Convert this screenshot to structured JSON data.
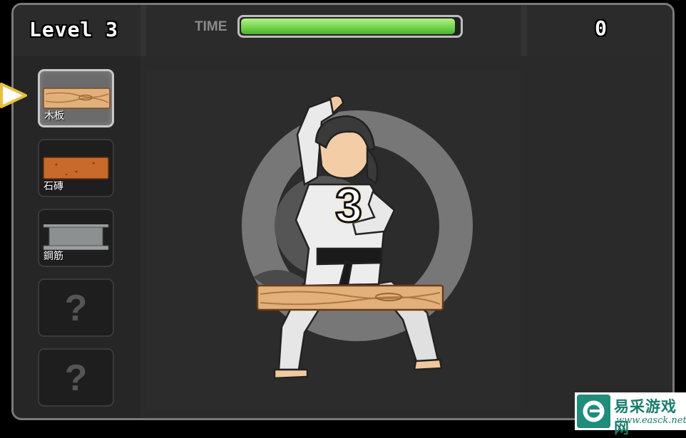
{
  "hud": {
    "level_label": "Level 3",
    "time_label": "TIME",
    "time_remaining_fraction": 0.98,
    "score": "0"
  },
  "materials": {
    "selected_index": 0,
    "items": [
      {
        "label": "木板",
        "icon": "wood-plank-icon",
        "locked": false
      },
      {
        "label": "石磚",
        "icon": "brick-icon",
        "locked": false
      },
      {
        "label": "鋼筋",
        "icon": "steel-beam-icon",
        "locked": false
      },
      {
        "label": "?",
        "icon": "locked-question-icon",
        "locked": true
      },
      {
        "label": "?",
        "icon": "locked-question-icon",
        "locked": true
      }
    ]
  },
  "stage": {
    "countdown": "3",
    "character": "karate-fighter",
    "target": "wood-plank"
  },
  "watermark": {
    "title": "易采游戏网",
    "url": "www.easck.net"
  },
  "colors": {
    "time_bar": "#6ed24a",
    "pointer": "#e8c040",
    "watermark": "#1a7c6c"
  }
}
